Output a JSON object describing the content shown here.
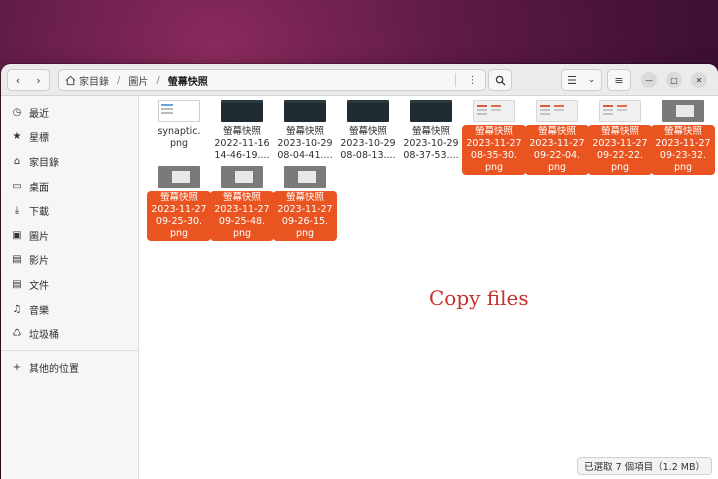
{
  "header": {
    "breadcrumbs": [
      "家目錄",
      "圖片",
      "螢幕快照"
    ]
  },
  "sidebar": {
    "items": [
      {
        "label": "最近",
        "icon": "clock-icon"
      },
      {
        "label": "星標",
        "icon": "star-icon"
      },
      {
        "label": "家目錄",
        "icon": "home-icon"
      },
      {
        "label": "桌面",
        "icon": "desktop-icon"
      },
      {
        "label": "下載",
        "icon": "download-icon"
      },
      {
        "label": "圖片",
        "icon": "image-icon"
      },
      {
        "label": "影片",
        "icon": "video-icon"
      },
      {
        "label": "文件",
        "icon": "document-icon"
      },
      {
        "label": "音樂",
        "icon": "music-icon"
      },
      {
        "label": "垃圾桶",
        "icon": "trash-icon"
      }
    ],
    "other_locations": {
      "label": "其他的位置",
      "icon": "plus-icon"
    }
  },
  "files": [
    {
      "name": "synaptic.\npng",
      "selected": false,
      "thumb": "white"
    },
    {
      "name": "螢幕快照\n2022-11-16\n14-46-19....",
      "selected": false,
      "thumb": "dark"
    },
    {
      "name": "螢幕快照\n2023-10-29\n08-04-41....",
      "selected": false,
      "thumb": "dark"
    },
    {
      "name": "螢幕快照\n2023-10-29\n08-08-13....",
      "selected": false,
      "thumb": "dark"
    },
    {
      "name": "螢幕快照\n2023-10-29\n08-37-53....",
      "selected": false,
      "thumb": "dark"
    },
    {
      "name": "螢幕快照\n2023-11-27\n08-35-30.\npng",
      "selected": true,
      "thumb": "light"
    },
    {
      "name": "螢幕快照\n2023-11-27\n09-22-04.\npng",
      "selected": true,
      "thumb": "light"
    },
    {
      "name": "螢幕快照\n2023-11-27\n09-22-22.\npng",
      "selected": true,
      "thumb": "light"
    },
    {
      "name": "螢幕快照\n2023-11-27\n09-23-32.\npng",
      "selected": true,
      "thumb": "gray"
    },
    {
      "name": "螢幕快照\n2023-11-27\n09-25-30.\npng",
      "selected": true,
      "thumb": "gray"
    },
    {
      "name": "螢幕快照\n2023-11-27\n09-25-48.\npng",
      "selected": true,
      "thumb": "gray"
    },
    {
      "name": "螢幕快照\n2023-11-27\n09-26-15.\npng",
      "selected": true,
      "thumb": "gray"
    }
  ],
  "overlay_text": "Copy files",
  "status": "已選取 7 個項目（1.2 MB）",
  "colors": {
    "selection": "#e95420",
    "annotation": "#c8302a"
  }
}
